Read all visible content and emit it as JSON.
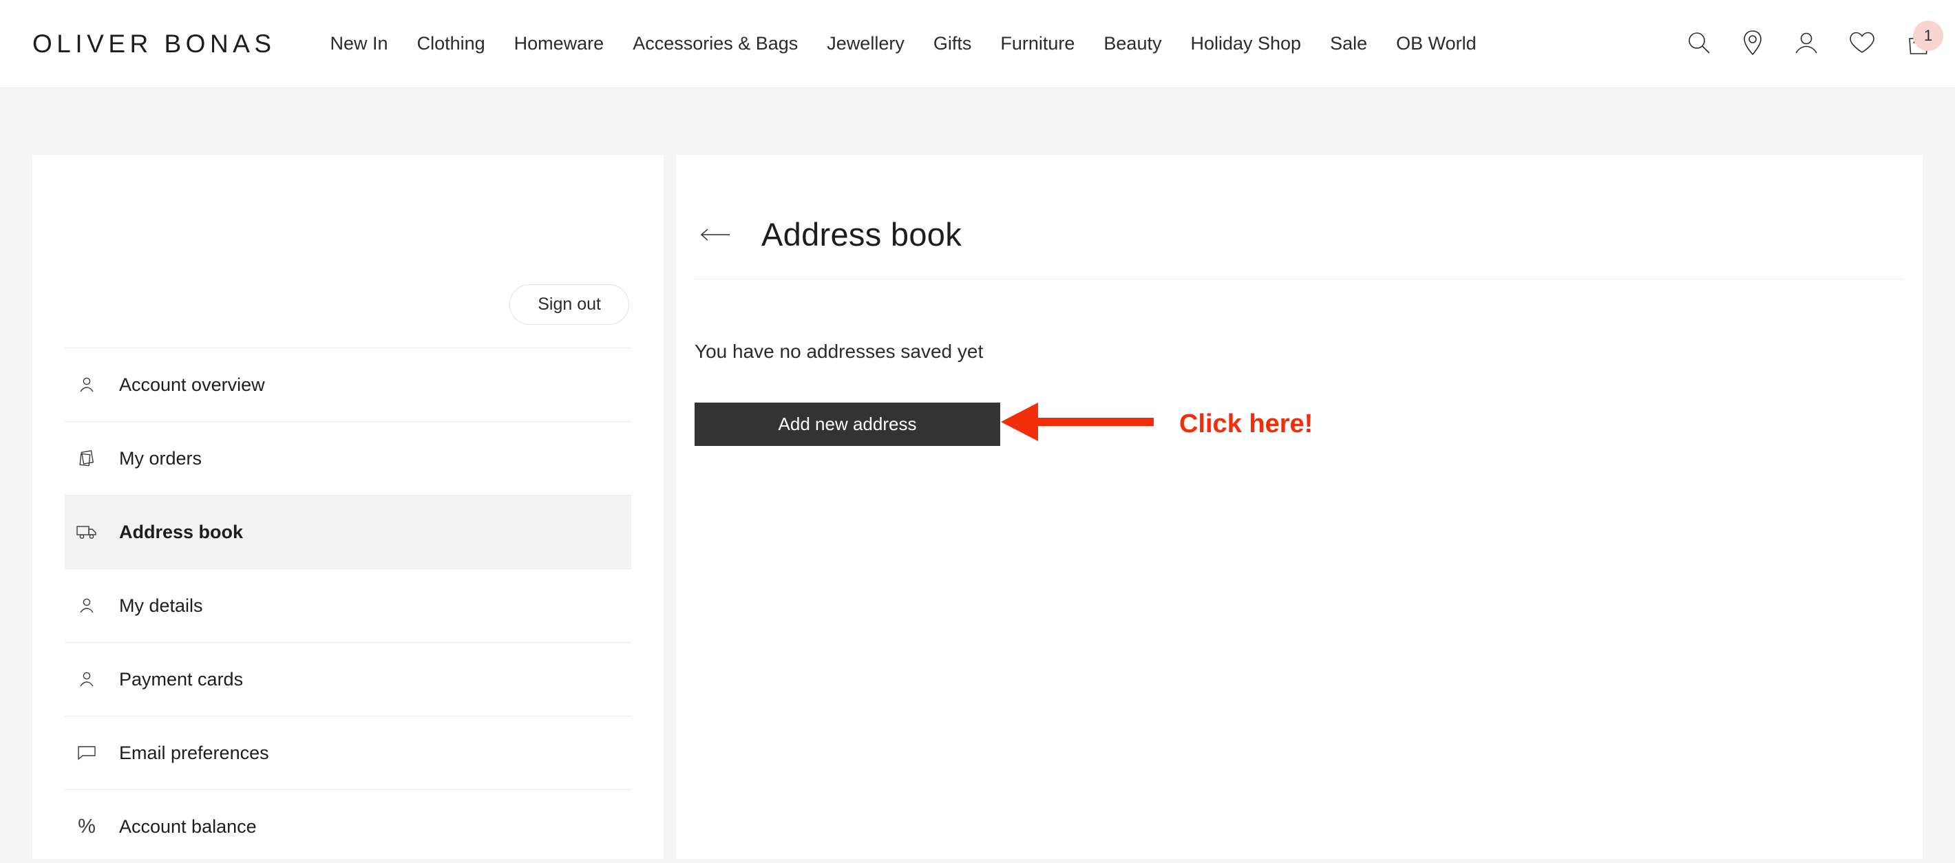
{
  "header": {
    "logo": "OLIVER BONAS",
    "nav": [
      {
        "label": "New In"
      },
      {
        "label": "Clothing"
      },
      {
        "label": "Homeware"
      },
      {
        "label": "Accessories & Bags"
      },
      {
        "label": "Jewellery"
      },
      {
        "label": "Gifts"
      },
      {
        "label": "Furniture"
      },
      {
        "label": "Beauty"
      },
      {
        "label": "Holiday Shop"
      },
      {
        "label": "Sale"
      },
      {
        "label": "OB World"
      }
    ],
    "icons": {
      "search": "search-icon",
      "store_locator": "location-pin-icon",
      "account": "account-person-icon",
      "wishlist": "heart-icon",
      "bag": "shopping-bag-icon"
    },
    "bag_count": "1",
    "bag_badge_color": "#f9d5d1"
  },
  "sidebar": {
    "sign_out_label": "Sign out",
    "items": [
      {
        "label": "Account overview",
        "icon": "person-icon",
        "active": false
      },
      {
        "label": "My orders",
        "icon": "documents-icon",
        "active": false
      },
      {
        "label": "Address book",
        "icon": "delivery-truck-icon",
        "active": true
      },
      {
        "label": "My details",
        "icon": "person-icon",
        "active": false
      },
      {
        "label": "Payment cards",
        "icon": "person-icon",
        "active": false
      },
      {
        "label": "Email preferences",
        "icon": "speech-bubble-icon",
        "active": false
      },
      {
        "label": "Account balance",
        "icon": "percent-icon",
        "active": false
      }
    ]
  },
  "main": {
    "back_icon": "back-arrow-icon",
    "title": "Address book",
    "empty_message": "You have no addresses saved yet",
    "add_button_label": "Add new address",
    "add_button_color": "#333333"
  },
  "annotation": {
    "text": "Click here!",
    "color": "#f22d0a",
    "arrow_direction": "left"
  }
}
